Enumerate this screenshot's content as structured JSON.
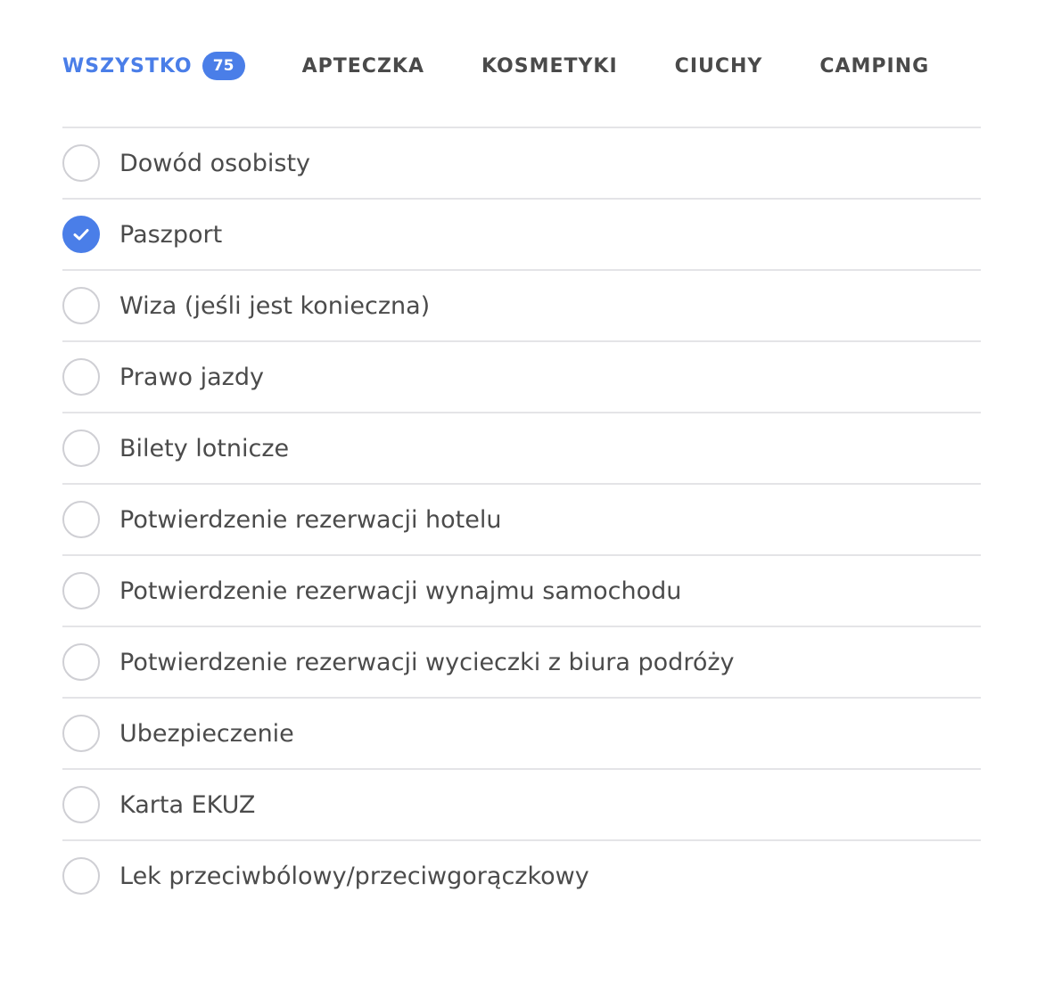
{
  "tabs": [
    {
      "label": "WSZYSTKO",
      "badge": "75",
      "active": true
    },
    {
      "label": "APTECZKA",
      "active": false
    },
    {
      "label": "KOSMETYKI",
      "active": false
    },
    {
      "label": "CIUCHY",
      "active": false
    },
    {
      "label": "CAMPING",
      "active": false
    }
  ],
  "items": [
    {
      "label": "Dowód osobisty",
      "checked": false
    },
    {
      "label": "Paszport",
      "checked": true
    },
    {
      "label": "Wiza (jeśli jest konieczna)",
      "checked": false
    },
    {
      "label": "Prawo jazdy",
      "checked": false
    },
    {
      "label": "Bilety lotnicze",
      "checked": false
    },
    {
      "label": "Potwierdzenie rezerwacji hotelu",
      "checked": false
    },
    {
      "label": "Potwierdzenie rezerwacji wynajmu samochodu",
      "checked": false
    },
    {
      "label": "Potwierdzenie rezerwacji wycieczki z biura podróży",
      "checked": false
    },
    {
      "label": "Ubezpieczenie",
      "checked": false
    },
    {
      "label": "Karta EKUZ",
      "checked": false
    },
    {
      "label": "Lek przeciwbólowy/przeciwgorączkowy",
      "checked": false
    }
  ],
  "colors": {
    "accent": "#4a7ee8",
    "text": "#4b4b4b",
    "divider": "#e4e4e7",
    "checkbox_border": "#cfcfd4"
  },
  "icons": {
    "checked": "checkmark-icon"
  }
}
